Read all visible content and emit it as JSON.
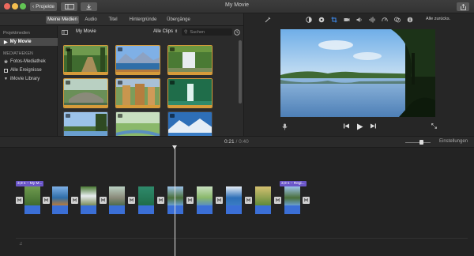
{
  "window": {
    "title": "My Movie"
  },
  "toolbar": {
    "projects_label": "Projekte"
  },
  "browser_tabs": [
    {
      "label": "Meine Medien"
    },
    {
      "label": "Audio"
    },
    {
      "label": "Titel"
    },
    {
      "label": "Hintergründe"
    },
    {
      "label": "Übergänge"
    }
  ],
  "library": {
    "projects_header": "Projektmedien",
    "project_item": "My Movie",
    "libraries_header": "MEDIATHEKEN",
    "items": [
      {
        "label": "Fotos-Mediathek"
      },
      {
        "label": "Alle Ereignisse"
      },
      {
        "label": "iMovie Library"
      }
    ]
  },
  "browser": {
    "title": "My Movie",
    "filter": "Alle Clips",
    "search_placeholder": "Suchen",
    "thumbnails": [
      {
        "scene": "forest-path",
        "used": true
      },
      {
        "scene": "mountain-lake",
        "used": true
      },
      {
        "scene": "waterfall",
        "used": true
      },
      {
        "scene": "stone-bridge",
        "used": true
      },
      {
        "scene": "rock-formations",
        "used": true
      },
      {
        "scene": "green-waterfall",
        "used": true
      },
      {
        "scene": "lake-tree",
        "used": false
      },
      {
        "scene": "meadow-stream",
        "used": false
      },
      {
        "scene": "snowy-mountains",
        "used": false
      }
    ]
  },
  "viewer": {
    "reset_label": "Alle zurücks."
  },
  "timeline": {
    "current_time": "0:21",
    "separator": "/",
    "total_time": "0:40",
    "settings_label": "Einstellungen",
    "label_start": "3,9 s – My M...",
    "label_end": "3,9 s – Regi..."
  },
  "colors": {
    "accent_orange": "#d69b3a",
    "clip_blue": "#3b6fd6",
    "title_purple": "#6b56c9"
  }
}
